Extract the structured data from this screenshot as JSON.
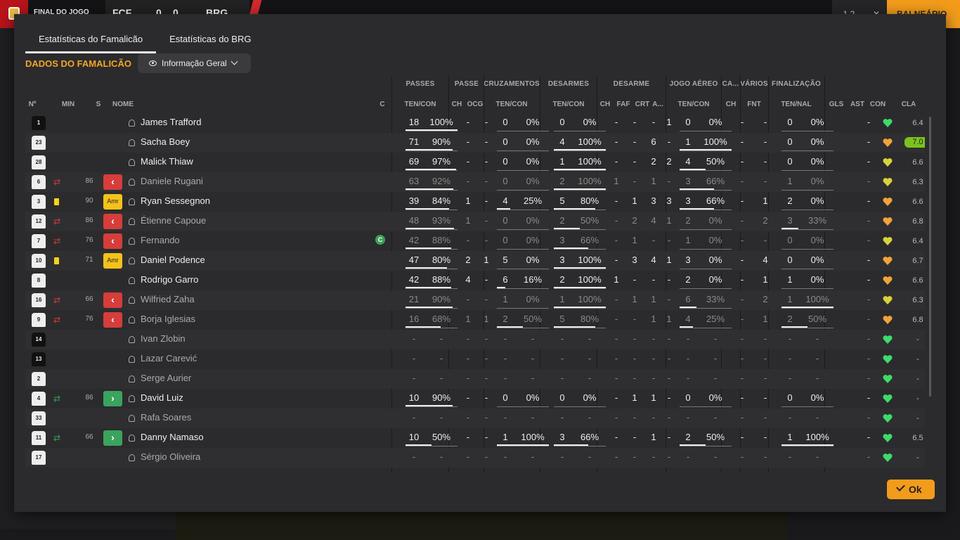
{
  "topbar": {
    "match_status": "FINAL DO JOGO",
    "home_abbr": "FCF",
    "home_score": "0",
    "away_score": "0",
    "away_abbr": "BRG",
    "button_1": "1 2",
    "button_2": "✕",
    "balneario_label": "BALNEÁRIO"
  },
  "tabs": [
    "Estatísticas do Famalicão",
    "Estatísticas do BRG"
  ],
  "section_title": "DADOS DO FAMALICÃO",
  "view_dropdown": "Informação Geral",
  "group_headers": {
    "passes": "PASSES",
    "passe": "PASSE",
    "cruzamentos": "CRUZAMENTOS",
    "desarmes": "DESARMES",
    "desarme": "DESARME",
    "jogo_aereo": "JOGO AÉREO",
    "ca": "CA...",
    "varios": "VÁRIOS",
    "finalizacao": "FINALIZAÇÃO"
  },
  "columns": {
    "num": "Nº",
    "min": "MIN",
    "s": "S",
    "name": "NOME",
    "c": "C",
    "passes": "TEN/CON",
    "passe_ch": "CH",
    "passe_ocg": "OCG",
    "cruz": "TEN/CON",
    "des": "TEN/CON",
    "d_ch": "CH",
    "d_faf": "FAF",
    "d_crt": "CRT",
    "d_a": "A...",
    "aereo": "TEN/CON",
    "ca_ch": "CH",
    "fnt": "FNT",
    "fin": "TEN/NAL",
    "gls": "GLS",
    "ast": "AST",
    "con": "CON",
    "cla": "CLA"
  },
  "players": [
    {
      "num": "1",
      "shirt": "gk",
      "name": "James Trafford",
      "sub": "",
      "min": "",
      "card": "",
      "subbtn": "",
      "captain": false,
      "dim": false,
      "passes": [
        "18",
        "100%"
      ],
      "passes_pct": 100,
      "pch": "-",
      "pocg": "-",
      "cruz": [
        "0",
        "0%"
      ],
      "cruz_pct": 0,
      "des": [
        "0",
        "0%"
      ],
      "des_pct": 0,
      "dch": "-",
      "faf": "-",
      "crt": "-",
      "da": "1",
      "aer": [
        "0",
        "0%"
      ],
      "aer_pct": 0,
      "cach": "-",
      "fnt": "-",
      "fin": [
        "0",
        "0%"
      ],
      "fin_pct": 0,
      "gls": "",
      "ast": "-",
      "con": "green",
      "cla": "6.4",
      "best": false
    },
    {
      "num": "23",
      "shirt": "w",
      "name": "Sacha Boey",
      "sub": "",
      "min": "",
      "card": "",
      "subbtn": "",
      "captain": false,
      "dim": false,
      "passes": [
        "71",
        "90%"
      ],
      "passes_pct": 90,
      "pch": "-",
      "pocg": "-",
      "cruz": [
        "0",
        "0%"
      ],
      "cruz_pct": 0,
      "des": [
        "4",
        "100%"
      ],
      "des_pct": 100,
      "dch": "-",
      "faf": "-",
      "crt": "6",
      "da": "-",
      "aer": [
        "1",
        "100%"
      ],
      "aer_pct": 100,
      "cach": "-",
      "fnt": "-",
      "fin": [
        "0",
        "0%"
      ],
      "fin_pct": 0,
      "gls": "",
      "ast": "-",
      "con": "orange",
      "cla": "7.0",
      "best": true
    },
    {
      "num": "28",
      "shirt": "w",
      "name": "Malick Thiaw",
      "sub": "",
      "min": "",
      "card": "",
      "subbtn": "",
      "captain": false,
      "dim": false,
      "passes": [
        "69",
        "97%"
      ],
      "passes_pct": 97,
      "pch": "-",
      "pocg": "-",
      "cruz": [
        "0",
        "0%"
      ],
      "cruz_pct": 0,
      "des": [
        "1",
        "100%"
      ],
      "des_pct": 100,
      "dch": "-",
      "faf": "-",
      "crt": "2",
      "da": "2",
      "aer": [
        "4",
        "50%"
      ],
      "aer_pct": 50,
      "cach": "-",
      "fnt": "-",
      "fin": [
        "0",
        "0%"
      ],
      "fin_pct": 0,
      "gls": "",
      "ast": "-",
      "con": "yellow",
      "cla": "6.6",
      "best": false
    },
    {
      "num": "6",
      "shirt": "w",
      "name": "Daniele Rugani",
      "sub": "out",
      "min": "86",
      "card": "",
      "subbtn": "out",
      "captain": false,
      "dim": true,
      "passes": [
        "63",
        "92%"
      ],
      "passes_pct": 92,
      "pch": "-",
      "pocg": "-",
      "cruz": [
        "0",
        "0%"
      ],
      "cruz_pct": 0,
      "des": [
        "2",
        "100%"
      ],
      "des_pct": 100,
      "dch": "1",
      "faf": "-",
      "crt": "1",
      "da": "-",
      "aer": [
        "3",
        "66%"
      ],
      "aer_pct": 66,
      "cach": "-",
      "fnt": "-",
      "fin": [
        "1",
        "0%"
      ],
      "fin_pct": 0,
      "gls": "",
      "ast": "-",
      "con": "yellow",
      "cla": "6.3",
      "best": false
    },
    {
      "num": "3",
      "shirt": "w",
      "name": "Ryan Sessegnon",
      "sub": "",
      "min": "90",
      "card": "yellow",
      "subbtn": "amr",
      "captain": false,
      "dim": false,
      "passes": [
        "39",
        "84%"
      ],
      "passes_pct": 84,
      "pch": "1",
      "pocg": "-",
      "cruz": [
        "4",
        "25%"
      ],
      "cruz_pct": 25,
      "des": [
        "5",
        "80%"
      ],
      "des_pct": 80,
      "dch": "-",
      "faf": "1",
      "crt": "3",
      "da": "3",
      "aer": [
        "3",
        "66%"
      ],
      "aer_pct": 66,
      "cach": "-",
      "fnt": "1",
      "fin": [
        "2",
        "0%"
      ],
      "fin_pct": 0,
      "gls": "",
      "ast": "-",
      "con": "orange",
      "cla": "6.6",
      "best": false
    },
    {
      "num": "12",
      "shirt": "w",
      "name": "Étienne Capoue",
      "sub": "out",
      "min": "86",
      "card": "",
      "subbtn": "out",
      "captain": false,
      "dim": true,
      "passes": [
        "48",
        "93%"
      ],
      "passes_pct": 93,
      "pch": "1",
      "pocg": "-",
      "cruz": [
        "0",
        "0%"
      ],
      "cruz_pct": 0,
      "des": [
        "2",
        "50%"
      ],
      "des_pct": 50,
      "dch": "-",
      "faf": "2",
      "crt": "4",
      "da": "1",
      "aer": [
        "2",
        "0%"
      ],
      "aer_pct": 0,
      "cach": "-",
      "fnt": "2",
      "fin": [
        "3",
        "33%"
      ],
      "fin_pct": 33,
      "gls": "",
      "ast": "-",
      "con": "orange",
      "cla": "6.8",
      "best": false
    },
    {
      "num": "7",
      "shirt": "w",
      "name": "Fernando",
      "sub": "out",
      "min": "76",
      "card": "",
      "subbtn": "out",
      "captain": true,
      "dim": true,
      "passes": [
        "42",
        "88%"
      ],
      "passes_pct": 88,
      "pch": "-",
      "pocg": "-",
      "cruz": [
        "0",
        "0%"
      ],
      "cruz_pct": 0,
      "des": [
        "3",
        "66%"
      ],
      "des_pct": 66,
      "dch": "-",
      "faf": "1",
      "crt": "-",
      "da": "-",
      "aer": [
        "1",
        "0%"
      ],
      "aer_pct": 0,
      "cach": "-",
      "fnt": "-",
      "fin": [
        "0",
        "0%"
      ],
      "fin_pct": 0,
      "gls": "",
      "ast": "-",
      "con": "yellow",
      "cla": "6.4",
      "best": false
    },
    {
      "num": "10",
      "shirt": "w",
      "name": "Daniel Podence",
      "sub": "",
      "min": "71",
      "card": "yellow",
      "subbtn": "amr",
      "captain": false,
      "dim": false,
      "passes": [
        "47",
        "80%"
      ],
      "passes_pct": 80,
      "pch": "2",
      "pocg": "1",
      "cruz": [
        "5",
        "0%"
      ],
      "cruz_pct": 0,
      "des": [
        "3",
        "100%"
      ],
      "des_pct": 100,
      "dch": "-",
      "faf": "3",
      "crt": "4",
      "da": "1",
      "aer": [
        "3",
        "0%"
      ],
      "aer_pct": 0,
      "cach": "-",
      "fnt": "4",
      "fin": [
        "0",
        "0%"
      ],
      "fin_pct": 0,
      "gls": "",
      "ast": "-",
      "con": "orange",
      "cla": "6.7",
      "best": false
    },
    {
      "num": "8",
      "shirt": "w",
      "name": "Rodrigo Garro",
      "sub": "",
      "min": "",
      "card": "",
      "subbtn": "",
      "captain": false,
      "dim": false,
      "passes": [
        "42",
        "88%"
      ],
      "passes_pct": 88,
      "pch": "4",
      "pocg": "-",
      "cruz": [
        "6",
        "16%"
      ],
      "cruz_pct": 16,
      "des": [
        "2",
        "100%"
      ],
      "des_pct": 100,
      "dch": "1",
      "faf": "-",
      "crt": "-",
      "da": "-",
      "aer": [
        "2",
        "0%"
      ],
      "aer_pct": 0,
      "cach": "-",
      "fnt": "1",
      "fin": [
        "1",
        "0%"
      ],
      "fin_pct": 0,
      "gls": "",
      "ast": "-",
      "con": "orange",
      "cla": "6.6",
      "best": false
    },
    {
      "num": "16",
      "shirt": "w",
      "name": "Wilfried Zaha",
      "sub": "out",
      "min": "66",
      "card": "",
      "subbtn": "out",
      "captain": false,
      "dim": true,
      "passes": [
        "21",
        "90%"
      ],
      "passes_pct": 90,
      "pch": "-",
      "pocg": "-",
      "cruz": [
        "1",
        "0%"
      ],
      "cruz_pct": 0,
      "des": [
        "1",
        "100%"
      ],
      "des_pct": 100,
      "dch": "-",
      "faf": "1",
      "crt": "1",
      "da": "-",
      "aer": [
        "6",
        "33%"
      ],
      "aer_pct": 33,
      "cach": "-",
      "fnt": "2",
      "fin": [
        "1",
        "100%"
      ],
      "fin_pct": 100,
      "gls": "",
      "ast": "-",
      "con": "yellow",
      "cla": "6.3",
      "best": false
    },
    {
      "num": "9",
      "shirt": "w",
      "name": "Borja Iglesias",
      "sub": "out",
      "min": "76",
      "card": "",
      "subbtn": "out",
      "captain": false,
      "dim": true,
      "passes": [
        "16",
        "68%"
      ],
      "passes_pct": 68,
      "pch": "1",
      "pocg": "1",
      "cruz": [
        "2",
        "50%"
      ],
      "cruz_pct": 50,
      "des": [
        "5",
        "80%"
      ],
      "des_pct": 80,
      "dch": "-",
      "faf": "-",
      "crt": "1",
      "da": "1",
      "aer": [
        "4",
        "25%"
      ],
      "aer_pct": 25,
      "cach": "-",
      "fnt": "1",
      "fin": [
        "2",
        "50%"
      ],
      "fin_pct": 50,
      "gls": "",
      "ast": "-",
      "con": "orange",
      "cla": "6.8",
      "best": false
    },
    {
      "num": "14",
      "shirt": "b",
      "name": "Ivan Zlobin",
      "sub": "",
      "min": "",
      "card": "",
      "subbtn": "",
      "captain": false,
      "dim": true,
      "passes": [
        "-",
        "-"
      ],
      "passes_pct": 0,
      "pch": "-",
      "pocg": "-",
      "cruz": [
        "-",
        "-"
      ],
      "cruz_pct": 0,
      "des": [
        "-",
        "-"
      ],
      "des_pct": 0,
      "dch": "-",
      "faf": "-",
      "crt": "-",
      "da": "-",
      "aer": [
        "-",
        "-"
      ],
      "aer_pct": 0,
      "cach": "-",
      "fnt": "-",
      "fin": [
        "-",
        "-"
      ],
      "fin_pct": 0,
      "gls": "",
      "ast": "-",
      "con": "green",
      "cla": "-",
      "best": false
    },
    {
      "num": "13",
      "shirt": "b",
      "name": "Lazar Carević",
      "sub": "",
      "min": "",
      "card": "",
      "subbtn": "",
      "captain": false,
      "dim": true,
      "passes": [
        "-",
        "-"
      ],
      "passes_pct": 0,
      "pch": "-",
      "pocg": "-",
      "cruz": [
        "-",
        "-"
      ],
      "cruz_pct": 0,
      "des": [
        "-",
        "-"
      ],
      "des_pct": 0,
      "dch": "-",
      "faf": "-",
      "crt": "-",
      "da": "-",
      "aer": [
        "-",
        "-"
      ],
      "aer_pct": 0,
      "cach": "-",
      "fnt": "-",
      "fin": [
        "-",
        "-"
      ],
      "fin_pct": 0,
      "gls": "",
      "ast": "-",
      "con": "green",
      "cla": "-",
      "best": false
    },
    {
      "num": "2",
      "shirt": "w",
      "name": "Serge Aurier",
      "sub": "",
      "min": "",
      "card": "",
      "subbtn": "",
      "captain": false,
      "dim": true,
      "passes": [
        "-",
        "-"
      ],
      "passes_pct": 0,
      "pch": "-",
      "pocg": "-",
      "cruz": [
        "-",
        "-"
      ],
      "cruz_pct": 0,
      "des": [
        "-",
        "-"
      ],
      "des_pct": 0,
      "dch": "-",
      "faf": "-",
      "crt": "-",
      "da": "-",
      "aer": [
        "-",
        "-"
      ],
      "aer_pct": 0,
      "cach": "-",
      "fnt": "-",
      "fin": [
        "-",
        "-"
      ],
      "fin_pct": 0,
      "gls": "",
      "ast": "-",
      "con": "green",
      "cla": "-",
      "best": false
    },
    {
      "num": "4",
      "shirt": "w",
      "name": "David Luiz",
      "sub": "in",
      "min": "86",
      "card": "",
      "subbtn": "in",
      "captain": false,
      "dim": false,
      "passes": [
        "10",
        "90%"
      ],
      "passes_pct": 90,
      "pch": "-",
      "pocg": "-",
      "cruz": [
        "0",
        "0%"
      ],
      "cruz_pct": 0,
      "des": [
        "0",
        "0%"
      ],
      "des_pct": 0,
      "dch": "-",
      "faf": "1",
      "crt": "1",
      "da": "-",
      "aer": [
        "0",
        "0%"
      ],
      "aer_pct": 0,
      "cach": "-",
      "fnt": "-",
      "fin": [
        "0",
        "0%"
      ],
      "fin_pct": 0,
      "gls": "",
      "ast": "-",
      "con": "green",
      "cla": "-",
      "best": false
    },
    {
      "num": "33",
      "shirt": "w",
      "name": "Rafa Soares",
      "sub": "",
      "min": "",
      "card": "",
      "subbtn": "",
      "captain": false,
      "dim": true,
      "passes": [
        "-",
        "-"
      ],
      "passes_pct": 0,
      "pch": "-",
      "pocg": "-",
      "cruz": [
        "-",
        "-"
      ],
      "cruz_pct": 0,
      "des": [
        "-",
        "-"
      ],
      "des_pct": 0,
      "dch": "-",
      "faf": "-",
      "crt": "-",
      "da": "-",
      "aer": [
        "-",
        "-"
      ],
      "aer_pct": 0,
      "cach": "-",
      "fnt": "-",
      "fin": [
        "-",
        "-"
      ],
      "fin_pct": 0,
      "gls": "",
      "ast": "-",
      "con": "green",
      "cla": "-",
      "best": false
    },
    {
      "num": "11",
      "shirt": "w",
      "name": "Danny Namaso",
      "sub": "in",
      "min": "66",
      "card": "",
      "subbtn": "in",
      "captain": false,
      "dim": false,
      "passes": [
        "10",
        "50%"
      ],
      "passes_pct": 50,
      "pch": "-",
      "pocg": "-",
      "cruz": [
        "1",
        "100%"
      ],
      "cruz_pct": 100,
      "des": [
        "3",
        "66%"
      ],
      "des_pct": 66,
      "dch": "-",
      "faf": "-",
      "crt": "1",
      "da": "-",
      "aer": [
        "2",
        "50%"
      ],
      "aer_pct": 50,
      "cach": "-",
      "fnt": "-",
      "fin": [
        "1",
        "100%"
      ],
      "fin_pct": 100,
      "gls": "",
      "ast": "-",
      "con": "green",
      "cla": "6.5",
      "best": false
    },
    {
      "num": "17",
      "shirt": "w",
      "name": "Sérgio Oliveira",
      "sub": "",
      "min": "",
      "card": "",
      "subbtn": "",
      "captain": false,
      "dim": true,
      "passes": [
        "-",
        "-"
      ],
      "passes_pct": 0,
      "pch": "-",
      "pocg": "-",
      "cruz": [
        "-",
        "-"
      ],
      "cruz_pct": 0,
      "des": [
        "-",
        "-"
      ],
      "des_pct": 0,
      "dch": "-",
      "faf": "-",
      "crt": "-",
      "da": "-",
      "aer": [
        "-",
        "-"
      ],
      "aer_pct": 0,
      "cach": "-",
      "fnt": "-",
      "fin": [
        "-",
        "-"
      ],
      "fin_pct": 0,
      "gls": "",
      "ast": "-",
      "con": "green",
      "cla": "-",
      "best": false
    }
  ],
  "amr_label": "Amr",
  "captain_label": "C",
  "ok_label": "Ok",
  "colors": {
    "accent": "#f39c1b",
    "section_title": "#f5a524",
    "sub_out": "#d63d3b",
    "sub_in": "#3aa35e",
    "best_rating": "#7cc21e",
    "con_green": "#3ddc6a",
    "con_orange": "#f2a33a",
    "con_yellow": "#d8d23a"
  }
}
